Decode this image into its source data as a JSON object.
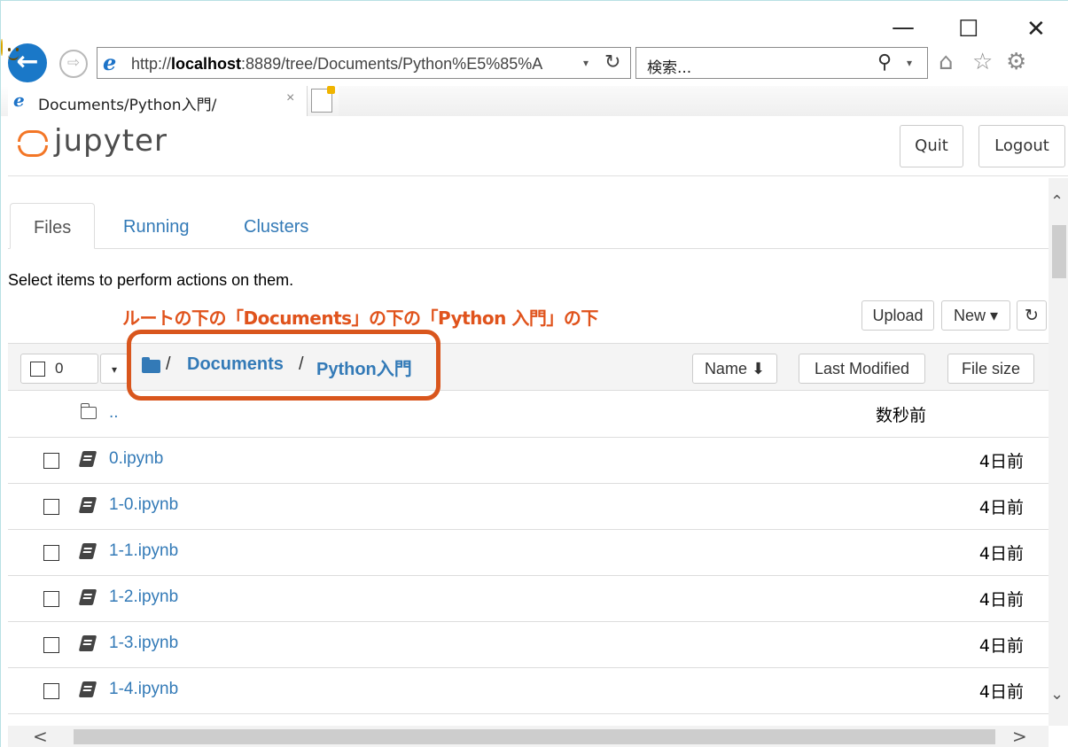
{
  "window": {
    "minimize": "—",
    "maximize": "☐",
    "close": "✕"
  },
  "addressbar": {
    "url_prefix": "http://",
    "url_host": "localhost",
    "url_rest": ":8889/tree/Documents/Python%E5%85%A",
    "dropdown": "▾",
    "refresh": "↻",
    "back": "←",
    "forward": "⇨",
    "ie_logo": "e"
  },
  "search": {
    "placeholder": "検索...",
    "icon": "⚲",
    "dropdown": "▾"
  },
  "toolbar_icons": {
    "home": "⌂",
    "favorites": "☆",
    "settings": "⚙"
  },
  "browser_tab": {
    "title": "Documents/Python入門/",
    "close": "×",
    "ie_logo": "e"
  },
  "header": {
    "logo_text": "jupyter",
    "quit": "Quit",
    "logout": "Logout"
  },
  "nav_tabs": [
    {
      "label": "Files",
      "active": true
    },
    {
      "label": "Running",
      "active": false
    },
    {
      "label": "Clusters",
      "active": false
    }
  ],
  "instructions": "Select items to perform actions on them.",
  "annotation": "ルートの下の「Documents」の下の「Python 入門」の下",
  "actions": {
    "upload": "Upload",
    "new": "New ▾",
    "refresh": "↻"
  },
  "list_header": {
    "selected_count": "0",
    "dropdown": "▾",
    "breadcrumb": [
      {
        "label": "Documents"
      },
      {
        "label": "Python入門"
      }
    ],
    "sep": "/",
    "sort_name": "Name ⬇",
    "sort_modified": "Last Modified",
    "sort_size": "File size"
  },
  "files": [
    {
      "name": "..",
      "modified": "数秒前",
      "type": "folder"
    },
    {
      "name": "0.ipynb",
      "modified": "4日前",
      "type": "notebook"
    },
    {
      "name": "1-0.ipynb",
      "modified": "4日前",
      "type": "notebook"
    },
    {
      "name": "1-1.ipynb",
      "modified": "4日前",
      "type": "notebook"
    },
    {
      "name": "1-2.ipynb",
      "modified": "4日前",
      "type": "notebook"
    },
    {
      "name": "1-3.ipynb",
      "modified": "4日前",
      "type": "notebook"
    },
    {
      "name": "1-4.ipynb",
      "modified": "4日前",
      "type": "notebook"
    }
  ],
  "scroll": {
    "up": "⌃",
    "down": "⌄",
    "left": "<",
    "right": ">"
  },
  "colors": {
    "link": "#337ab7",
    "annotation": "#e0531c",
    "jupyter_orange": "#f37626",
    "ie_blue": "#1a78c8"
  }
}
